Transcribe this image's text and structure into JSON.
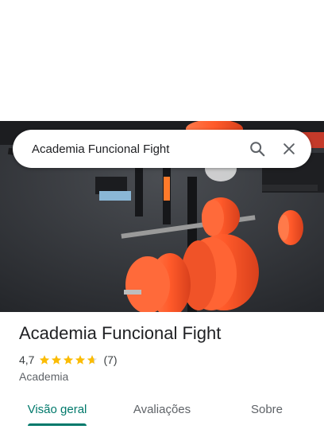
{
  "search": {
    "query": "Academia Funcional Fight",
    "search_icon": "search-icon",
    "close_icon": "close-icon"
  },
  "place": {
    "name": "Academia Funcional Fight",
    "rating": "4,7",
    "stars": 4.7,
    "reviews": "(7)",
    "category": "Academia"
  },
  "tabs": [
    {
      "label": "Visão geral",
      "active": true
    },
    {
      "label": "Avaliações",
      "active": false
    },
    {
      "label": "Sobre",
      "active": false
    }
  ],
  "colors": {
    "accent": "#00796b",
    "star": "#fbbc04"
  }
}
